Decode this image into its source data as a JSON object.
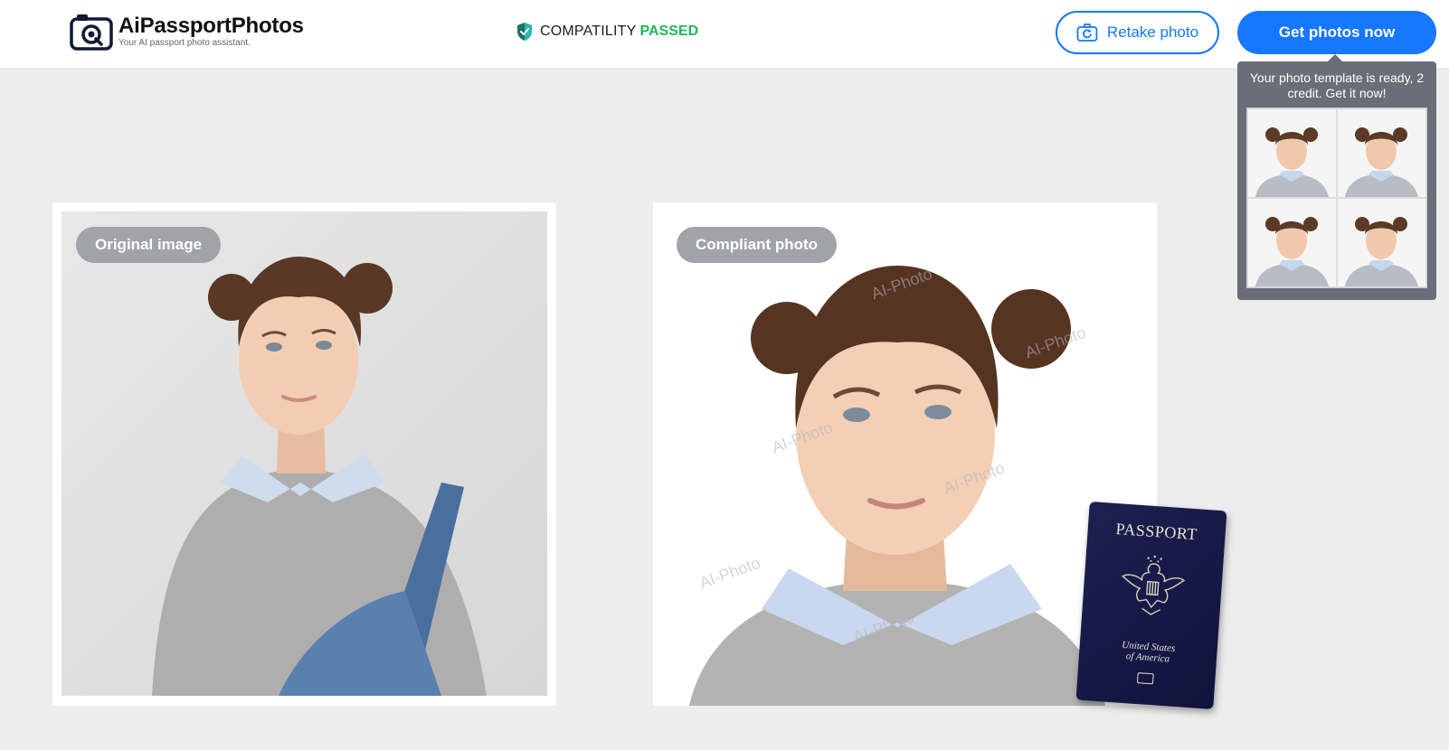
{
  "header": {
    "brand_title": "AiPassportPhotos",
    "brand_subtitle": "Your AI passport photo assistant.",
    "compatibility_label": "COMPATILITY",
    "compatibility_status": "PASSED",
    "retake_label": "Retake photo",
    "get_label": "Get photos now"
  },
  "popover": {
    "message": "Your photo template is ready, 2 credit. Get it now!"
  },
  "cards": {
    "original_label": "Original image",
    "compliant_label": "Compliant photo",
    "watermark_text": "AI-Photo"
  },
  "passport": {
    "title": "PASSPORT",
    "country_line1": "United States",
    "country_line2": "of America"
  },
  "colors": {
    "primary": "#1677ff",
    "success": "#22b55a",
    "background": "#ededed",
    "pill": "#a1a3a8",
    "popover": "#6b6e78"
  }
}
